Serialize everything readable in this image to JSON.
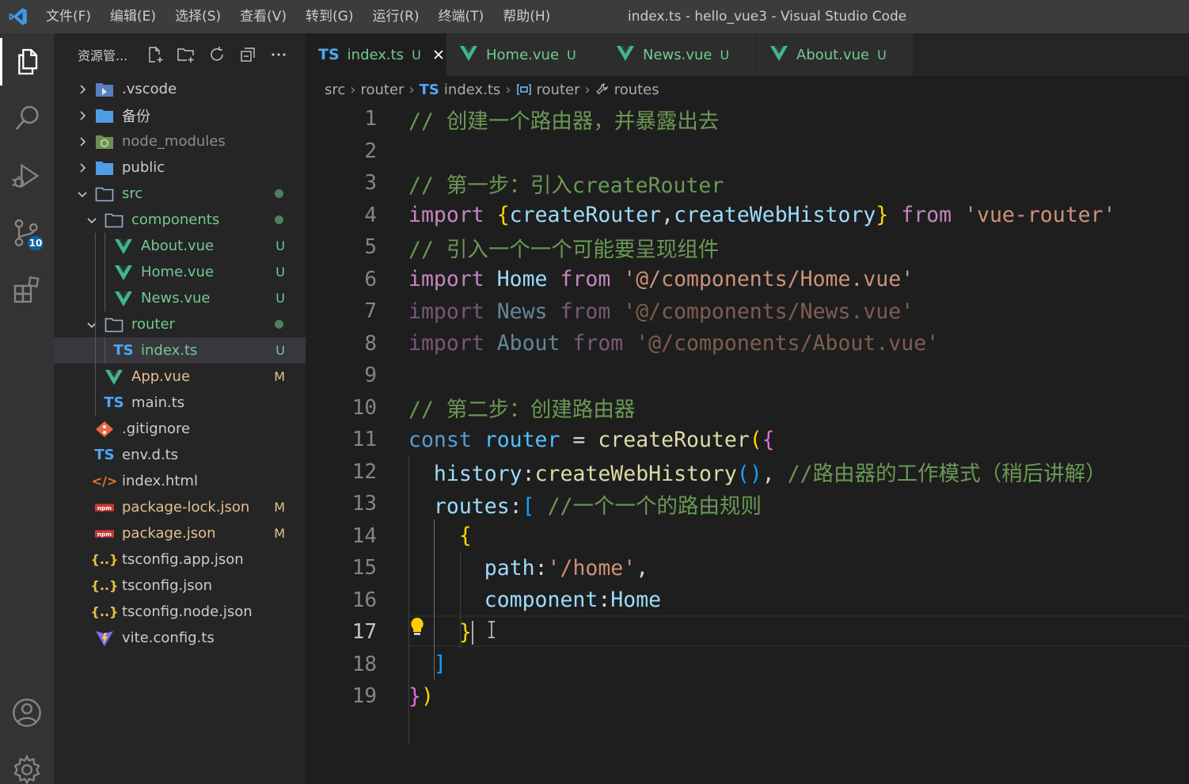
{
  "window": {
    "title": "index.ts - hello_vue3 - Visual Studio Code"
  },
  "menu": [
    "文件(F)",
    "编辑(E)",
    "选择(S)",
    "查看(V)",
    "转到(G)",
    "运行(R)",
    "终端(T)",
    "帮助(H)"
  ],
  "activity_bar": {
    "items": [
      {
        "icon": "explorer-icon"
      },
      {
        "icon": "search-icon"
      },
      {
        "icon": "run-debug-icon"
      },
      {
        "icon": "source-control-icon",
        "badge": "10"
      },
      {
        "icon": "extensions-icon"
      }
    ],
    "bottom": [
      {
        "icon": "account-icon"
      },
      {
        "icon": "settings-gear-icon"
      }
    ]
  },
  "sidebar": {
    "title": "资源管...",
    "actions": [
      "new-file-icon",
      "new-folder-icon",
      "refresh-icon",
      "collapse-all-icon",
      "more-icon"
    ],
    "tree": [
      {
        "label": ".vscode",
        "type": "folder",
        "expanded": false,
        "depth": 0,
        "status": "",
        "color": "#cccccc"
      },
      {
        "label": "备份",
        "type": "folder",
        "expanded": false,
        "depth": 0,
        "status": "",
        "color": "#cccccc"
      },
      {
        "label": "node_modules",
        "type": "folder",
        "expanded": false,
        "depth": 0,
        "status": "",
        "color": "#8c8c8c"
      },
      {
        "label": "public",
        "type": "folder",
        "expanded": false,
        "depth": 0,
        "status": "",
        "color": "#cccccc"
      },
      {
        "label": "src",
        "type": "folder",
        "expanded": true,
        "depth": 0,
        "status": "dot",
        "color": "#73c991"
      },
      {
        "label": "components",
        "type": "folder",
        "expanded": true,
        "depth": 1,
        "status": "dot",
        "color": "#73c991"
      },
      {
        "label": "About.vue",
        "type": "vue",
        "depth": 2,
        "status": "U",
        "color": "#73c991"
      },
      {
        "label": "Home.vue",
        "type": "vue",
        "depth": 2,
        "status": "U",
        "color": "#73c991"
      },
      {
        "label": "News.vue",
        "type": "vue",
        "depth": 2,
        "status": "U",
        "color": "#73c991"
      },
      {
        "label": "router",
        "type": "folder",
        "expanded": true,
        "depth": 1,
        "status": "dot",
        "color": "#73c991"
      },
      {
        "label": "index.ts",
        "type": "ts",
        "depth": 2,
        "status": "U",
        "color": "#73c991",
        "selected": true
      },
      {
        "label": "App.vue",
        "type": "vue",
        "depth": 1,
        "status": "M",
        "color": "#e2c08d"
      },
      {
        "label": "main.ts",
        "type": "ts",
        "depth": 1,
        "status": "",
        "color": "#cccccc"
      },
      {
        "label": ".gitignore",
        "type": "git",
        "depth": 0,
        "status": "",
        "color": "#cccccc"
      },
      {
        "label": "env.d.ts",
        "type": "ts",
        "depth": 0,
        "status": "",
        "color": "#cccccc"
      },
      {
        "label": "index.html",
        "type": "html",
        "depth": 0,
        "status": "",
        "color": "#cccccc"
      },
      {
        "label": "package-lock.json",
        "type": "npm",
        "depth": 0,
        "status": "M",
        "color": "#e2c08d"
      },
      {
        "label": "package.json",
        "type": "npm",
        "depth": 0,
        "status": "M",
        "color": "#e2c08d"
      },
      {
        "label": "tsconfig.app.json",
        "type": "json",
        "depth": 0,
        "status": "",
        "color": "#cccccc"
      },
      {
        "label": "tsconfig.json",
        "type": "json",
        "depth": 0,
        "status": "",
        "color": "#cccccc"
      },
      {
        "label": "tsconfig.node.json",
        "type": "json",
        "depth": 0,
        "status": "",
        "color": "#cccccc"
      },
      {
        "label": "vite.config.ts",
        "type": "vite",
        "depth": 0,
        "status": "",
        "color": "#cccccc"
      }
    ]
  },
  "tabs": [
    {
      "label": "index.ts",
      "icon": "TS",
      "status": "U",
      "active": true
    },
    {
      "label": "Home.vue",
      "icon": "V",
      "status": "U",
      "active": false
    },
    {
      "label": "News.vue",
      "icon": "V",
      "status": "U",
      "active": false
    },
    {
      "label": "About.vue",
      "icon": "V",
      "status": "U",
      "active": false
    }
  ],
  "breadcrumbs": {
    "src": "src",
    "router_folder": "router",
    "file_icon": "TS",
    "file": "index.ts",
    "symbol1": "router",
    "symbol2": "routes"
  },
  "editor": {
    "current_line": 17,
    "lines": [
      {
        "n": "1",
        "tokens": [
          [
            "c-com",
            "// 创建一个路由器，并暴露出去"
          ]
        ]
      },
      {
        "n": "2",
        "tokens": []
      },
      {
        "n": "3",
        "tokens": [
          [
            "c-com",
            "// 第一步：引入createRouter"
          ]
        ]
      },
      {
        "n": "4",
        "tokens": [
          [
            "c-kw",
            "import "
          ],
          [
            "c-b1",
            "{"
          ],
          [
            "c-var",
            "createRouter"
          ],
          [
            "c-white",
            ","
          ],
          [
            "c-var",
            "createWebHistory"
          ],
          [
            "c-b1",
            "}"
          ],
          [
            "c-kw",
            " from "
          ],
          [
            "c-str",
            "'vue-router'"
          ]
        ]
      },
      {
        "n": "5",
        "tokens": [
          [
            "c-com",
            "// 引入一个一个可能要呈现组件"
          ]
        ]
      },
      {
        "n": "6",
        "tokens": [
          [
            "c-kw",
            "import "
          ],
          [
            "c-var",
            "Home"
          ],
          [
            "c-kw",
            " from "
          ],
          [
            "c-str",
            "'@/components/Home.vue'"
          ]
        ]
      },
      {
        "n": "7",
        "tokens": [
          [
            "c-kw c-dim",
            "import "
          ],
          [
            "c-var c-dim",
            "News"
          ],
          [
            "c-kw c-dim",
            " from "
          ],
          [
            "c-str c-dim",
            "'@/components/News.vue'"
          ]
        ]
      },
      {
        "n": "8",
        "tokens": [
          [
            "c-kw c-dim",
            "import "
          ],
          [
            "c-var c-dim",
            "About"
          ],
          [
            "c-kw c-dim",
            " from "
          ],
          [
            "c-str c-dim",
            "'@/components/About.vue'"
          ]
        ]
      },
      {
        "n": "9",
        "tokens": []
      },
      {
        "n": "10",
        "tokens": [
          [
            "c-com",
            "// 第二步：创建路由器"
          ]
        ]
      },
      {
        "n": "11",
        "tokens": [
          [
            "c-kw2",
            "const "
          ],
          [
            "c-var2",
            "router"
          ],
          [
            "c-white",
            " = "
          ],
          [
            "c-fn",
            "createRouter"
          ],
          [
            "c-b1",
            "("
          ],
          [
            "c-b2",
            "{"
          ]
        ]
      },
      {
        "n": "12",
        "tokens": [
          [
            "c-white",
            "  "
          ],
          [
            "c-var",
            "history"
          ],
          [
            "c-white",
            ":"
          ],
          [
            "c-fn",
            "createWebHistory"
          ],
          [
            "c-b3",
            "()"
          ],
          [
            "c-white",
            ", "
          ],
          [
            "c-com",
            "//路由器的工作模式（稍后讲解）"
          ]
        ]
      },
      {
        "n": "13",
        "tokens": [
          [
            "c-white",
            "  "
          ],
          [
            "c-var",
            "routes"
          ],
          [
            "c-white",
            ":"
          ],
          [
            "c-b3",
            "["
          ],
          [
            "c-white",
            " "
          ],
          [
            "c-com",
            "//一个一个的路由规则"
          ]
        ]
      },
      {
        "n": "14",
        "tokens": [
          [
            "c-white",
            "    "
          ],
          [
            "c-b1",
            "{"
          ]
        ]
      },
      {
        "n": "15",
        "tokens": [
          [
            "c-white",
            "      "
          ],
          [
            "c-var",
            "path"
          ],
          [
            "c-white",
            ":"
          ],
          [
            "c-str",
            "'/home'"
          ],
          [
            "c-white",
            ","
          ]
        ]
      },
      {
        "n": "16",
        "tokens": [
          [
            "c-white",
            "      "
          ],
          [
            "c-var",
            "component"
          ],
          [
            "c-white",
            ":"
          ],
          [
            "c-var",
            "Home"
          ]
        ]
      },
      {
        "n": "17",
        "tokens": [
          [
            "c-white",
            "    "
          ],
          [
            "c-b1",
            "}"
          ]
        ]
      },
      {
        "n": "18",
        "tokens": [
          [
            "c-white",
            "  "
          ],
          [
            "c-b3",
            "]"
          ]
        ]
      },
      {
        "n": "19",
        "tokens": [
          [
            "c-b2",
            "}"
          ],
          [
            "c-b1",
            ")"
          ]
        ]
      }
    ]
  }
}
